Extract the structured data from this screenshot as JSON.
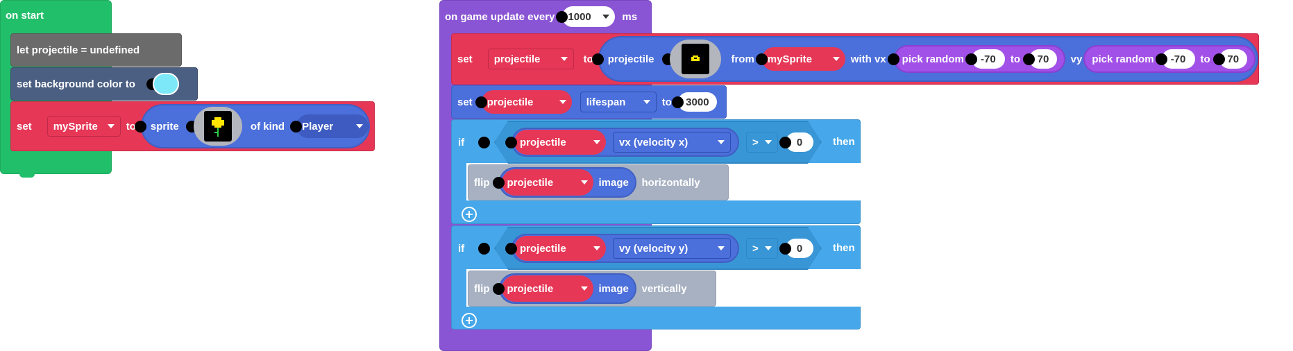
{
  "colors": {
    "events_green": "#22bf6a",
    "variables_red": "#e63756",
    "sprites_blue": "#4b6fdb",
    "logic_blue": "#46a8ea",
    "game_purple": "#8a55d4",
    "math_purple": "#a251e8",
    "grey_block": "#6b6b6b",
    "scene_slate": "#4b5f82",
    "flip_grey": "#a7b1c2",
    "bg_swatch": "#7de8f8"
  },
  "on_start": {
    "hat_label": "on start",
    "let_block": {
      "label": "let projectile = undefined"
    },
    "bg_block": {
      "label": "set background color to"
    },
    "set_block": {
      "set_label": "set",
      "var_name": "mySprite",
      "to_label": "to",
      "sprite_label": "sprite",
      "of_kind_label": "of kind",
      "kind": "Player"
    }
  },
  "game_update": {
    "hat_label": "on game update every",
    "interval": "1000",
    "unit": "ms",
    "set_projectile": {
      "set_label": "set",
      "var_name": "projectile",
      "to_label": "to",
      "projectile_label": "projectile",
      "from_label": "from",
      "from_sprite": "mySprite",
      "with_vx_label": "with vx",
      "vx_random_label": "pick random",
      "vx_min": "-70",
      "vx_to_label": "to",
      "vx_max": "70",
      "vy_label": "vy",
      "vy_random_label": "pick random",
      "vy_min": "-70",
      "vy_to_label": "to",
      "vy_max": "70"
    },
    "set_lifespan": {
      "set_label": "set",
      "sprite": "projectile",
      "property": "lifespan",
      "to_label": "to",
      "value": "3000"
    },
    "if_vx": {
      "if_label": "if",
      "sprite": "projectile",
      "property": "vx (velocity x)",
      "operator": ">",
      "value": "0",
      "then_label": "then",
      "flip": {
        "flip_label": "flip",
        "sprite": "projectile",
        "image_label": "image",
        "direction": "horizontally"
      }
    },
    "if_vy": {
      "if_label": "if",
      "sprite": "projectile",
      "property": "vy (velocity y)",
      "operator": ">",
      "value": "0",
      "then_label": "then",
      "flip": {
        "flip_label": "flip",
        "sprite": "projectile",
        "image_label": "image",
        "direction": "vertically"
      }
    },
    "add_icon": "plus-circle-icon"
  }
}
